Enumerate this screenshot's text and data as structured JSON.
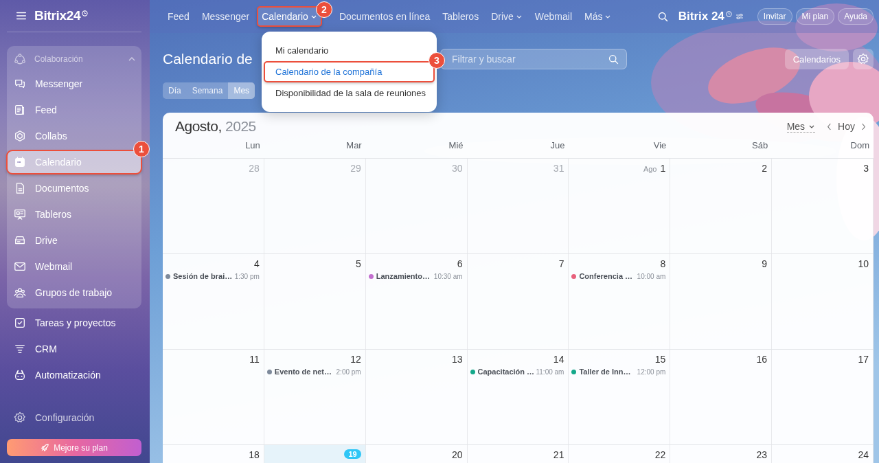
{
  "sidebar": {
    "logo": "Bitrix24",
    "group": {
      "label": "Colaboración",
      "expanded": true,
      "items": [
        {
          "label": "Messenger",
          "selected": false
        },
        {
          "label": "Feed",
          "selected": false
        },
        {
          "label": "Collabs",
          "selected": false
        },
        {
          "label": "Calendario",
          "selected": true,
          "callout": "1"
        },
        {
          "label": "Documentos",
          "selected": false
        },
        {
          "label": "Tableros",
          "selected": false
        },
        {
          "label": "Drive",
          "selected": false
        },
        {
          "label": "Webmail",
          "selected": false
        },
        {
          "label": "Grupos de trabajo",
          "selected": false
        }
      ]
    },
    "items": [
      {
        "label": "Tareas y proyectos"
      },
      {
        "label": "CRM"
      },
      {
        "label": "Automatización"
      }
    ],
    "settings": "Configuración",
    "upgrade": "Mejore su plan"
  },
  "topnav": {
    "items": [
      {
        "label": "Feed",
        "dropdown": false,
        "selected": false
      },
      {
        "label": "Messenger",
        "dropdown": false,
        "selected": false
      },
      {
        "label": "Calendario",
        "dropdown": true,
        "selected": true,
        "callout": "2"
      },
      {
        "label": "Documentos en línea",
        "dropdown": false,
        "selected": false
      },
      {
        "label": "Tableros",
        "dropdown": false,
        "selected": false
      },
      {
        "label": "Drive",
        "dropdown": true,
        "selected": false
      },
      {
        "label": "Webmail",
        "dropdown": false,
        "selected": false
      },
      {
        "label": "Más",
        "dropdown": true,
        "selected": false
      }
    ],
    "brand": "Bitrix 24",
    "buttons": [
      "Invitar",
      "Mi plan",
      "Ayuda"
    ]
  },
  "dropdown_menu": [
    {
      "label": "Mi calendario",
      "selected": false
    },
    {
      "label": "Calendario de la compañía",
      "selected": true,
      "callout": "3"
    },
    {
      "label": "Disponibilidad de la sala de reuniones",
      "selected": false
    }
  ],
  "page": {
    "title": "Calendario de",
    "view_tabs": [
      {
        "label": "Día",
        "selected": false
      },
      {
        "label": "Semana",
        "selected": false
      },
      {
        "label": "Mes",
        "selected": true
      }
    ],
    "search": {
      "placeholder": "Filtrar y buscar"
    },
    "calendars_button": "Calendarios"
  },
  "calendar": {
    "month": "Agosto,",
    "year": "2025",
    "view": "Mes",
    "today_button": "Hoy",
    "weekdays": [
      "Lun",
      "Mar",
      "Mié",
      "Jue",
      "Vie",
      "Sáb",
      "Dom"
    ],
    "weeks": [
      [
        {
          "day": "28",
          "other_month": true
        },
        {
          "day": "29",
          "other_month": true
        },
        {
          "day": "30",
          "other_month": true
        },
        {
          "day": "31",
          "other_month": true
        },
        {
          "day": "1",
          "month_label": "Ago",
          "other_month": false
        },
        {
          "day": "2",
          "other_month": false
        },
        {
          "day": "3",
          "other_month": false
        }
      ],
      [
        {
          "day": "4",
          "other_month": false,
          "events": [
            {
              "title": "Sesión de brai…",
              "time": "1:30 pm",
              "color": "#7e8a9b"
            }
          ]
        },
        {
          "day": "5",
          "other_month": false
        },
        {
          "day": "6",
          "other_month": false,
          "events": [
            {
              "title": "Lanzamiento…",
              "time": "10:30 am",
              "color": "#c26fcf"
            }
          ]
        },
        {
          "day": "7",
          "other_month": false
        },
        {
          "day": "8",
          "other_month": false,
          "events": [
            {
              "title": "Conferencia …",
              "time": "10:00 am",
              "color": "#e8617c"
            }
          ]
        },
        {
          "day": "9",
          "other_month": false
        },
        {
          "day": "10",
          "other_month": false
        }
      ],
      [
        {
          "day": "11",
          "other_month": false
        },
        {
          "day": "12",
          "other_month": false,
          "events": [
            {
              "title": "Evento de net…",
              "time": "2:00 pm",
              "color": "#7e8a9b"
            }
          ]
        },
        {
          "day": "13",
          "other_month": false
        },
        {
          "day": "14",
          "other_month": false,
          "events": [
            {
              "title": "Capacitación …",
              "time": "11:00 am",
              "color": "#14a88a"
            }
          ]
        },
        {
          "day": "15",
          "other_month": false,
          "events": [
            {
              "title": "Taller de Inn…",
              "time": "12:00 pm",
              "color": "#14a88a"
            }
          ]
        },
        {
          "day": "16",
          "other_month": false
        },
        {
          "day": "17",
          "other_month": false
        }
      ],
      [
        {
          "day": "18",
          "other_month": false
        },
        {
          "day": "19",
          "other_month": false,
          "today": true
        },
        {
          "day": "20",
          "other_month": false
        },
        {
          "day": "21",
          "other_month": false
        },
        {
          "day": "22",
          "other_month": false
        },
        {
          "day": "23",
          "other_month": false
        },
        {
          "day": "24",
          "other_month": false
        }
      ]
    ]
  }
}
